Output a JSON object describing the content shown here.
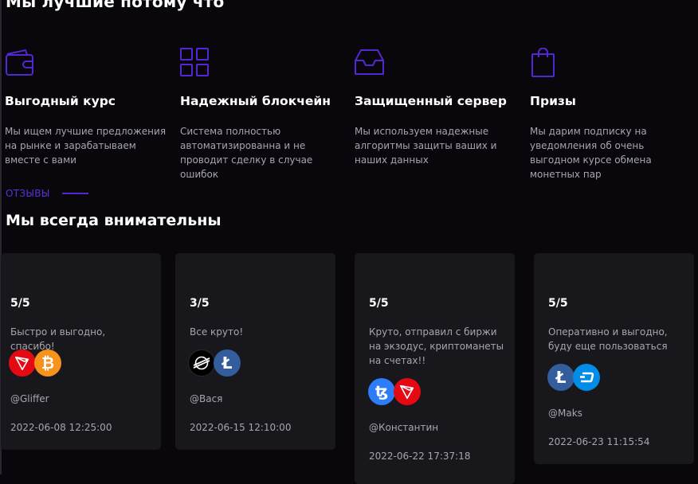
{
  "page": {
    "heading_top": "Мы лучшие потому что",
    "reviews_label": "ОТЗЫВЫ",
    "heading_reviews": "Мы всегда внимательны"
  },
  "features": [
    {
      "icon": "wallet-icon",
      "title": "Выгодный курс",
      "desc": "Мы ищем лучшие предложения на рынке и зарабатываем вместе с вами"
    },
    {
      "icon": "grid-icon",
      "title": "Надежный блокчейн",
      "desc": "Система полностью автоматизированна и не проводит сделку в случае ошибок"
    },
    {
      "icon": "inbox-icon",
      "title": "Защищенный сервер",
      "desc": "Мы используем надежные алгоритмы защиты ваших и наших данных"
    },
    {
      "icon": "shopping-bag-icon",
      "title": "Призы",
      "desc": "Мы дарим подписку на уведомления об очень выгодном курсе обмена монетных пар"
    }
  ],
  "reviews": [
    {
      "rating": "5/5",
      "text": "Быстро и выгодно, спасибо!",
      "coins": [
        "tron-coin-icon",
        "bitcoin-coin-icon"
      ],
      "author": "@Gliffer",
      "date": "2022-06-08 12:25:00"
    },
    {
      "rating": "3/5",
      "text": "Все круто!",
      "coins": [
        "stellar-coin-icon",
        "litecoin-coin-icon"
      ],
      "author": "@Вася",
      "date": "2022-06-15 12:10:00"
    },
    {
      "rating": "5/5",
      "text": "Круто, отправил с биржи на экзодус, криптоманеты на счетах!!",
      "coins": [
        "tezos-coin-icon",
        "tron-coin-icon"
      ],
      "author": "@Константин",
      "date": "2022-06-22 17:37:18"
    },
    {
      "rating": "5/5",
      "text": "Оперативно и выгодно, буду еще пользоваться",
      "coins": [
        "litecoin-coin-icon",
        "dash-coin-icon"
      ],
      "author": "@Maks",
      "date": "2022-06-23 11:15:54"
    }
  ],
  "colors": {
    "background": "#09070c",
    "card": "#18171c",
    "accent": "#5128d3",
    "muted_text": "#a6a6ad",
    "tron": "#e50914",
    "bitcoin": "#f7931a",
    "litecoin": "#345d9d",
    "tezos": "#2c7df7",
    "dash": "#008ce7"
  }
}
